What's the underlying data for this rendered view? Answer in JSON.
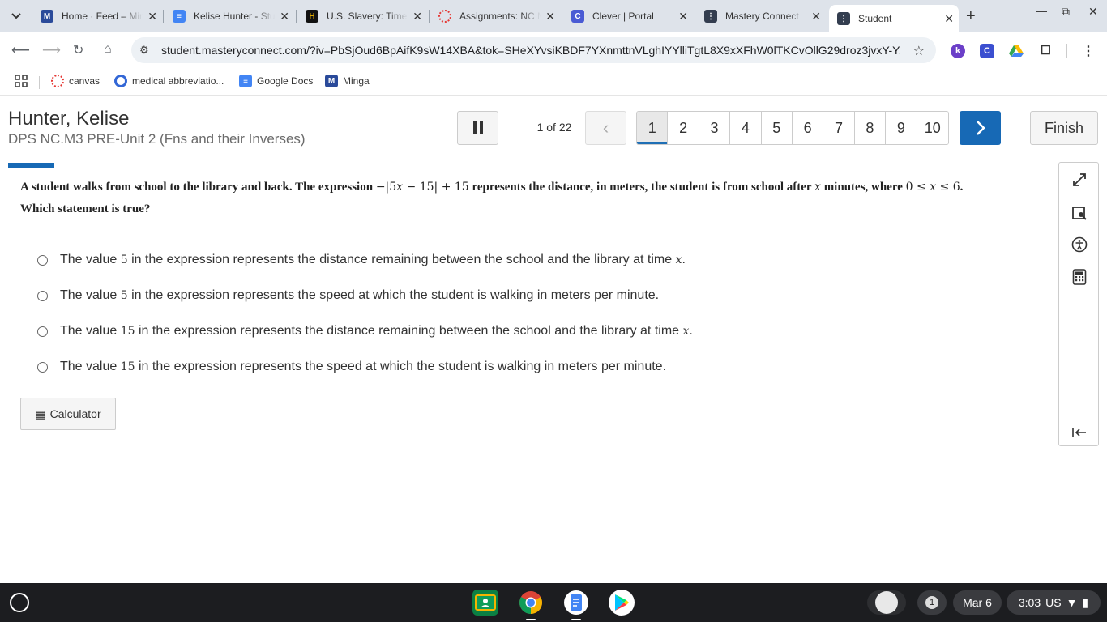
{
  "browser": {
    "tabs": [
      {
        "title": "Home · Feed – Minga",
        "favicon_color": "#2a4a9a",
        "favicon_letter": "M"
      },
      {
        "title": "Kelise Hunter - Student",
        "favicon_color": "#4285f4",
        "favicon_letter": "≡"
      },
      {
        "title": "U.S. Slavery: Timeline",
        "favicon_color": "#111111",
        "favicon_letter": "H"
      },
      {
        "title": "Assignments: NC Math",
        "favicon_color": "#e53935",
        "favicon_letter": "◌"
      },
      {
        "title": "Clever | Portal",
        "favicon_color": "#4a5bd4",
        "favicon_letter": "C"
      },
      {
        "title": "Mastery Connect",
        "favicon_color": "#333d4f",
        "favicon_letter": "⋮"
      },
      {
        "title": "Student",
        "favicon_color": "#333d4f",
        "favicon_letter": "⋮"
      }
    ],
    "url": "student.masteryconnect.com/?iv=PbSjOud6BpAifK9sW14XBA&tok=SHeXYvsiKBDF7YXnmttnVLghIYYlliTgtL8X9xXFhW0lTKCvOllG29droz3jvxY-Y...",
    "bookmarks": [
      {
        "label": "canvas",
        "color": "#e53935"
      },
      {
        "label": "medical abbreviatio...",
        "color": "#3367d6"
      },
      {
        "label": "Google Docs",
        "color": "#4285f4"
      },
      {
        "label": "Minga",
        "color": "#2a4a9a"
      }
    ]
  },
  "header": {
    "student_name": "Hunter, Kelise",
    "assessment_title": "DPS NC.M3 PRE-Unit 2 (Fns and their Inverses)",
    "page_count": "1 of 22",
    "question_numbers": [
      "1",
      "2",
      "3",
      "4",
      "5",
      "6",
      "7",
      "8",
      "9",
      "10"
    ],
    "current_question": "1",
    "finish_label": "Finish"
  },
  "question": {
    "text_before": "A student walks from school to the library and back. The expression ",
    "text_middle": " represents the distance, in meters, the student is from school after ",
    "text_after": " minutes, where ",
    "prompt": "Which statement is true?",
    "choices": [
      {
        "pre": "The value ",
        "num": "5",
        "post": " in the expression represents the distance remaining between the school and the library at time ",
        "var": "x",
        "end": "."
      },
      {
        "pre": "The value ",
        "num": "5",
        "post": " in the expression represents the speed at which the student is walking in meters per minute.",
        "var": "",
        "end": ""
      },
      {
        "pre": "The value ",
        "num": "15",
        "post": " in the expression represents the distance remaining between the school and the library at time ",
        "var": "x",
        "end": "."
      },
      {
        "pre": "The value ",
        "num": "15",
        "post": " in the expression represents the speed at which the student is walking in meters per minute.",
        "var": "",
        "end": ""
      }
    ]
  },
  "calculator_label": "Calculator",
  "progress_fraction": 0.045,
  "taskbar": {
    "notification_count": "1",
    "date": "Mar 6",
    "time": "3:03",
    "locale": "US"
  },
  "colors": {
    "accent": "#1769b5"
  }
}
